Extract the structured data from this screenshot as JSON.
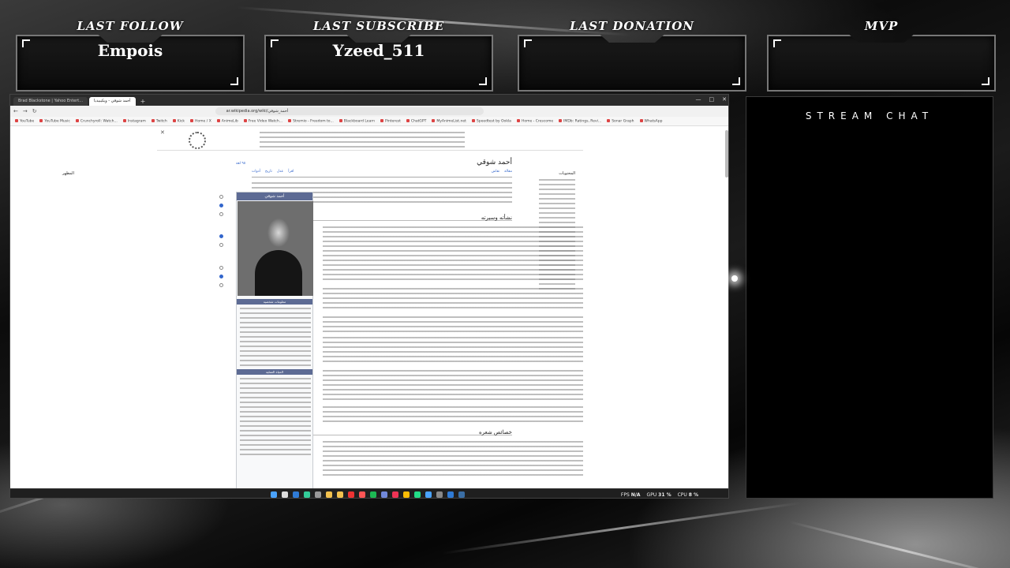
{
  "overlay": {
    "stats": [
      {
        "title": "LAST FOLLOW",
        "value": "Empois"
      },
      {
        "title": "LAST SUBSCRIBE",
        "value": "Yzeed_511"
      },
      {
        "title": "LAST DONATION",
        "value": ""
      },
      {
        "title": "MVP",
        "value": ""
      }
    ],
    "chat_title": "STREAM CHAT"
  },
  "browser": {
    "tabs": [
      {
        "label": "Brad Blackstone | Yahoo Entert..."
      },
      {
        "label": "أحمد شوقي - ويكيبيديا"
      }
    ],
    "new_tab": "+",
    "address": "ar.wikipedia.org/wiki/أحمد_شوقي",
    "bookmarks": [
      "YouTube",
      "YouTube Music",
      "Crunchyroll: Watch...",
      "Instagram",
      "Twitch",
      "Kick",
      "Home / X",
      "AnimeLib",
      "Free Video Watch...",
      "Stremio - Freedom to...",
      "Blackboard Learn",
      "Pinterest",
      "ChatGPT",
      "MyAnimeList.net",
      "Speedtest by Ookla",
      "Home - Crescome",
      "IMDb: Ratings, Revi...",
      "Sonar Graph",
      "WhatsApp"
    ]
  },
  "wiki": {
    "article_title": "أحمد شوقي",
    "tabs": [
      "مقالة",
      "نقاش",
      "اقرأ",
      "عدل",
      "تاريخ",
      "أدوات"
    ],
    "sections": [
      "نشأته وسيرته",
      "خصائص شعره"
    ],
    "infobox_title": "أحمد شوقي",
    "infobox_band1": "معلومات شخصية",
    "infobox_band2": "الحياة العملية",
    "right_sidebar_title": "المحتويات",
    "left_sidebar_title": "المظهر",
    "languages_link": "٩٥ لغة"
  },
  "taskbar": {
    "fps_label": "FPS",
    "fps_value": "N/A",
    "gpu_label": "GPU",
    "gpu_value": "31 %",
    "cpu_label": "CPU",
    "cpu_value": "8 %"
  }
}
